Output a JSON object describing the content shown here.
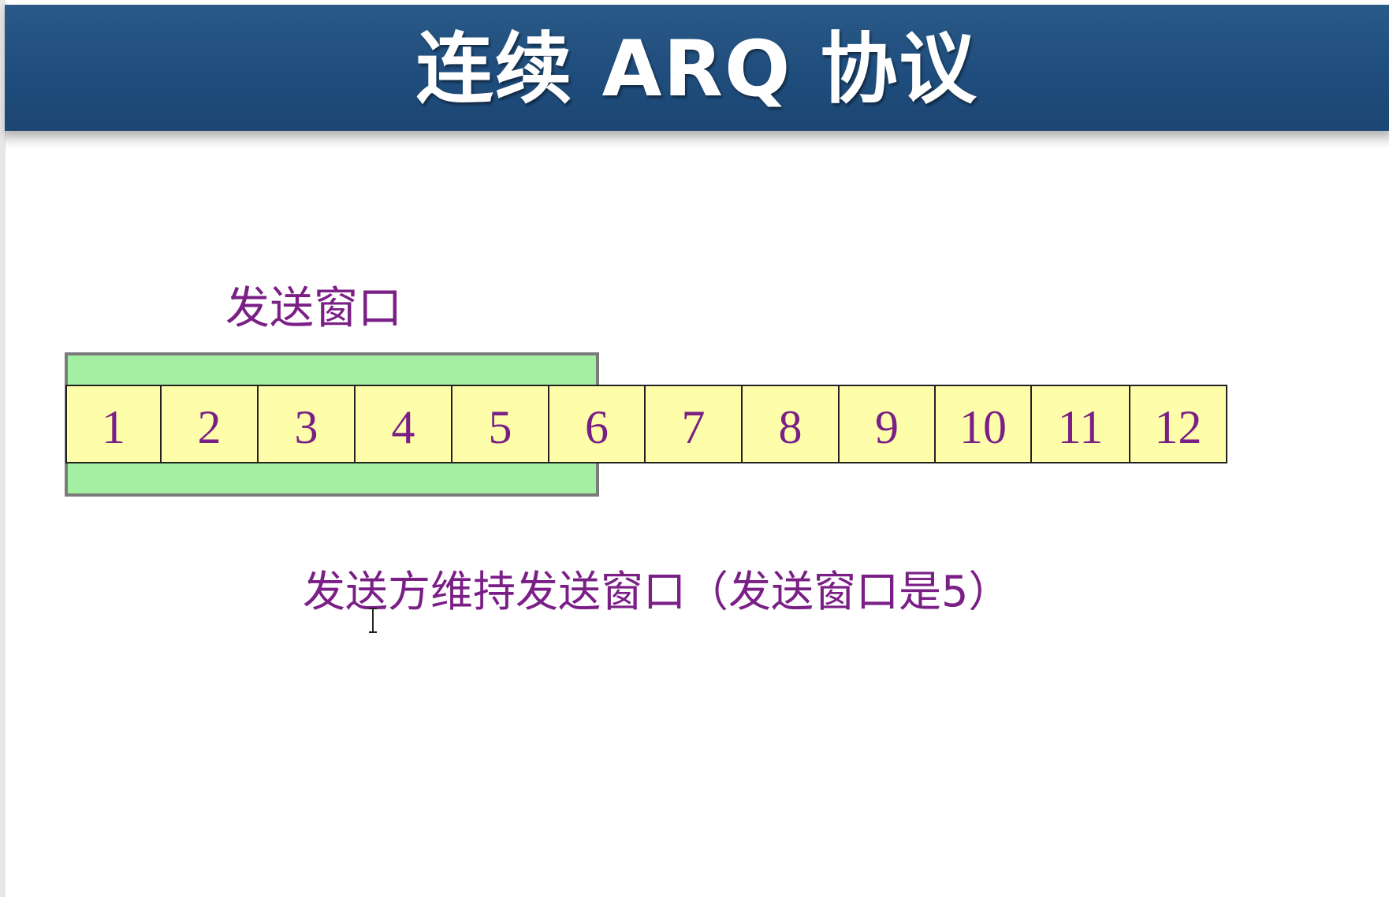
{
  "slide": {
    "title": "连续 ARQ 协议",
    "window_label": "发送窗口",
    "caption": "发送方维持发送窗口（发送窗口是5）"
  },
  "diagram": {
    "sequence_numbers": [
      "1",
      "2",
      "3",
      "4",
      "5",
      "6",
      "7",
      "8",
      "9",
      "10",
      "11",
      "12"
    ],
    "window_size": 5,
    "colors": {
      "title_bar": "#1f4d7d",
      "window_fill": "#a3f0a3",
      "cell_fill": "#fefeaa",
      "text_purple": "#7a1f86"
    }
  }
}
